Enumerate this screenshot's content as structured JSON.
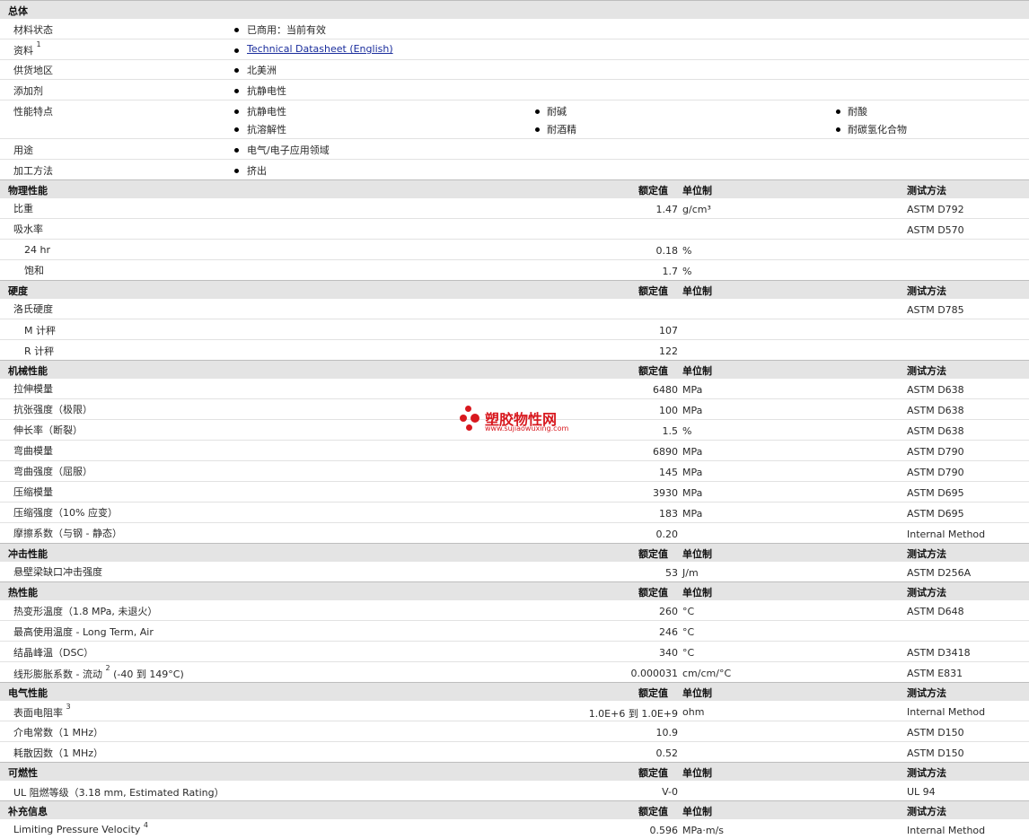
{
  "general": {
    "title": "总体",
    "status_label": "材料状态",
    "status_value": "已商用：当前有效",
    "doc_label": "资料",
    "doc_sup": "1",
    "doc_link": "Technical Datasheet (English)",
    "region_label": "供货地区",
    "region_value": "北美洲",
    "additive_label": "添加剂",
    "additive_value": "抗静电性",
    "features_label": "性能特点",
    "features": [
      "抗静电性",
      "耐碱",
      "耐酸",
      "抗溶解性",
      "耐酒精",
      "耐碳氢化合物"
    ],
    "use_label": "用途",
    "use_value": "电气/电子应用领域",
    "process_label": "加工方法",
    "process_value": "挤出"
  },
  "header_labels": {
    "value": "额定值",
    "unit": "单位制",
    "method": "测试方法"
  },
  "physical": {
    "title": "物理性能",
    "sg_label": "比重",
    "sg_value": "1.47",
    "sg_unit": "g/cm³",
    "sg_method": "ASTM D792",
    "wa_label": "吸水率",
    "wa_method": "ASTM D570",
    "wa24_label": "24 hr",
    "wa24_value": "0.18",
    "wa24_unit": "%",
    "wasat_label": "饱和",
    "wasat_value": "1.7",
    "wasat_unit": "%"
  },
  "hardness": {
    "title": "硬度",
    "rh_label": "洛氏硬度",
    "rh_method": "ASTM D785",
    "m_label": "M 计秤",
    "m_value": "107",
    "r_label": "R 计秤",
    "r_value": "122"
  },
  "mechanical": {
    "title": "机械性能",
    "rows": [
      {
        "label": "拉伸模量",
        "value": "6480",
        "unit": "MPa",
        "method": "ASTM D638"
      },
      {
        "label": "抗张强度（极限）",
        "value": "100",
        "unit": "MPa",
        "method": "ASTM D638"
      },
      {
        "label": "伸长率（断裂）",
        "value": "1.5",
        "unit": "%",
        "method": "ASTM D638"
      },
      {
        "label": "弯曲模量",
        "value": "6890",
        "unit": "MPa",
        "method": "ASTM D790"
      },
      {
        "label": "弯曲强度（屈服）",
        "value": "145",
        "unit": "MPa",
        "method": "ASTM D790"
      },
      {
        "label": "压缩模量",
        "value": "3930",
        "unit": "MPa",
        "method": "ASTM D695"
      },
      {
        "label": "压缩强度（10% 应变）",
        "value": "183",
        "unit": "MPa",
        "method": "ASTM D695"
      },
      {
        "label": "摩擦系数（与钢 - 静态）",
        "value": "0.20",
        "unit": "",
        "method": "Internal Method"
      }
    ]
  },
  "impact": {
    "title": "冲击性能",
    "label": "悬壁梁缺口冲击强度",
    "value": "53",
    "unit": "J/m",
    "method": "ASTM D256A"
  },
  "thermal": {
    "title": "热性能",
    "hdt_label": "热变形温度（1.8 MPa, 未退火）",
    "hdt_value": "260",
    "hdt_unit": "°C",
    "hdt_method": "ASTM D648",
    "mst_label": "最高使用温度 - Long Term, Air",
    "mst_value": "246",
    "mst_unit": "°C",
    "pk_label": "结晶峰温（DSC）",
    "pk_value": "340",
    "pk_unit": "°C",
    "pk_method": "ASTM D3418",
    "cte_label_a": "线形膨胀系数 - 流动",
    "cte_sup": "2",
    "cte_label_b": "(-40 到 149°C)",
    "cte_value": "0.000031",
    "cte_unit": "cm/cm/°C",
    "cte_method": "ASTM E831"
  },
  "electrical": {
    "title": "电气性能",
    "sr_label": "表面电阻率",
    "sr_sup": "3",
    "sr_value": "1.0E+6 到 1.0E+9",
    "sr_unit": "ohm",
    "sr_method": "Internal Method",
    "dc_label": "介电常数（1 MHz）",
    "dc_value": "10.9",
    "dc_method": "ASTM D150",
    "df_label": "耗散因数（1 MHz）",
    "df_value": "0.52",
    "df_method": "ASTM D150"
  },
  "flammability": {
    "title": "可燃性",
    "label": "UL 阻燃等级（3.18 mm, Estimated Rating）",
    "value": "V-0",
    "method": "UL 94"
  },
  "supplemental": {
    "title": "补充信息",
    "label": "Limiting Pressure Velocity",
    "sup": "4",
    "value": "0.596",
    "unit": "MPa·m/s",
    "method": "Internal Method"
  },
  "watermark": {
    "name": "塑胶物性网",
    "url": "www.sujiaowuxing.com"
  },
  "colors": {
    "section_bg": "#e4e4e4",
    "link": "#1a2d9c",
    "watermark": "#d8181e"
  }
}
